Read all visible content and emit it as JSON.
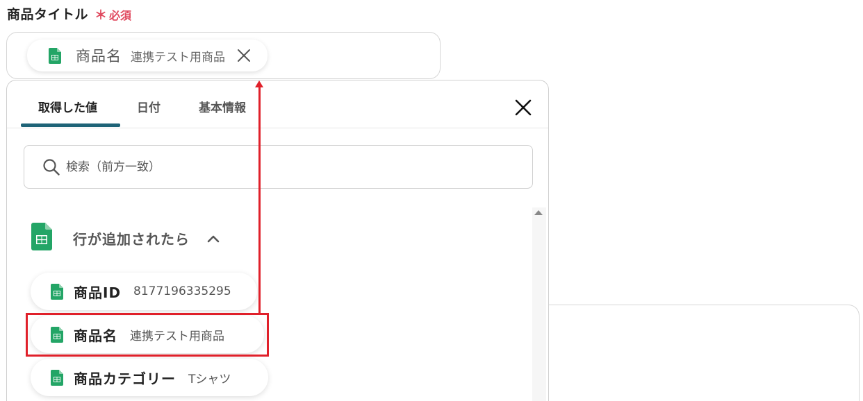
{
  "field": {
    "label": "商品タイトル",
    "required_mark": "＊",
    "required_text": "必須",
    "selected_chip": {
      "icon": "google-sheets-icon",
      "name": "商品名",
      "value": "連携テスト用商品"
    }
  },
  "panel": {
    "tabs": [
      {
        "label": "取得した値",
        "active": true
      },
      {
        "label": "日付",
        "active": false
      },
      {
        "label": "基本情報",
        "active": false
      }
    ],
    "search": {
      "placeholder": "検索（前方一致）",
      "value": ""
    },
    "section": {
      "icon": "google-sheets-icon",
      "title": "行が追加されたら",
      "expanded": true,
      "items": [
        {
          "name": "商品ID",
          "value": "8177196335295"
        },
        {
          "name": "商品名",
          "value": "連携テスト用商品",
          "highlighted": true
        },
        {
          "name": "商品カテゴリー",
          "value": "Tシャツ"
        }
      ]
    }
  },
  "colors": {
    "accent": "#1e6377",
    "required": "#e04a5f",
    "highlight": "#e0202a",
    "sheets_green": "#23a566"
  }
}
